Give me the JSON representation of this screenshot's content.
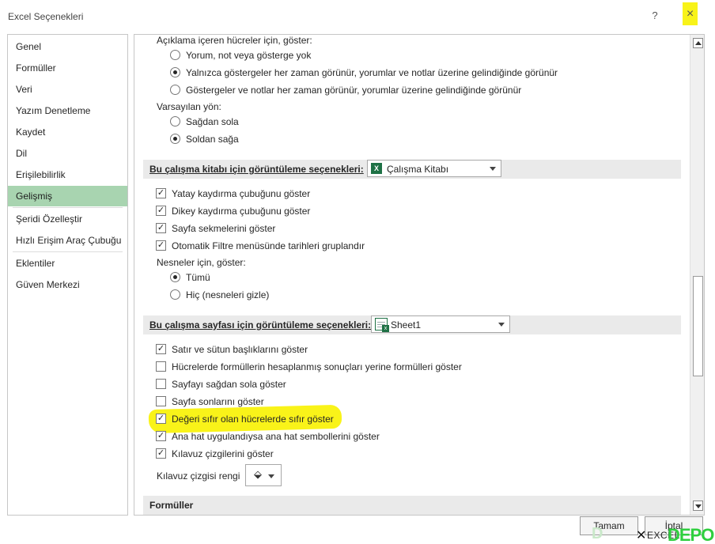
{
  "window": {
    "title": "Excel Seçenekleri",
    "help": "?",
    "close": "×"
  },
  "nav": [
    {
      "label": "Genel",
      "selected": false
    },
    {
      "label": "Formüller",
      "selected": false
    },
    {
      "label": "Veri",
      "selected": false
    },
    {
      "label": "Yazım Denetleme",
      "selected": false
    },
    {
      "label": "Kaydet",
      "selected": false
    },
    {
      "label": "Dil",
      "selected": false
    },
    {
      "label": "Erişilebilirlik",
      "selected": false
    },
    {
      "label": "Gelişmiş",
      "selected": true
    },
    {
      "label": "Şeridi Özelleştir",
      "selected": false
    },
    {
      "label": "Hızlı Erişim Araç Çubuğu",
      "selected": false
    },
    {
      "label": "Eklentiler",
      "selected": false
    },
    {
      "label": "Güven Merkezi",
      "selected": false
    }
  ],
  "comments": {
    "heading": "Açıklama içeren hücreler için, göster:",
    "options": [
      {
        "label": "Yorum, not veya gösterge yok",
        "checked": false
      },
      {
        "label": "Yalnızca göstergeler her zaman görünür, yorumlar ve notlar üzerine gelindiğinde görünür",
        "checked": true
      },
      {
        "label": "Göstergeler ve notlar her zaman görünür, yorumlar üzerine gelindiğinde görünür",
        "checked": false
      }
    ]
  },
  "direction": {
    "heading": "Varsayılan yön:",
    "options": [
      {
        "label": "Sağdan sola",
        "checked": false
      },
      {
        "label": "Soldan sağa",
        "checked": true
      }
    ]
  },
  "workbook_section": {
    "title": "Bu çalışma kitabı için görüntüleme seçenekleri:",
    "dropdown": "Çalışma Kitabı",
    "checks": [
      {
        "label": "Yatay kaydırma çubuğunu göster",
        "checked": true
      },
      {
        "label": "Dikey kaydırma çubuğunu göster",
        "checked": true
      },
      {
        "label": "Sayfa sekmelerini göster",
        "checked": true
      },
      {
        "label": "Otomatik Filtre menüsünde tarihleri gruplandır",
        "checked": true
      }
    ],
    "objects_heading": "Nesneler için, göster:",
    "objects": [
      {
        "label": "Tümü",
        "checked": true
      },
      {
        "label": "Hiç (nesneleri gizle)",
        "checked": false
      }
    ]
  },
  "sheet_section": {
    "title": "Bu çalışma sayfası için görüntüleme seçenekleri:",
    "dropdown": "Sheet1",
    "checks": [
      {
        "label": "Satır ve sütun başlıklarını göster",
        "checked": true
      },
      {
        "label": "Hücrelerde formüllerin hesaplanmış sonuçları yerine formülleri göster",
        "checked": false
      },
      {
        "label": "Sayfayı sağdan sola göster",
        "checked": false
      },
      {
        "label": "Sayfa sonlarını göster",
        "checked": false
      },
      {
        "label": "Değeri sıfır olan hücrelerde sıfır göster",
        "checked": true
      },
      {
        "label": "Ana hat uygulandıysa ana hat sembollerini göster",
        "checked": true
      },
      {
        "label": "Kılavuz çizgilerini göster",
        "checked": true
      }
    ],
    "gridline_color_label": "Kılavuz çizgisi rengi"
  },
  "formulas_section": {
    "title": "Formüller"
  },
  "buttons": {
    "ok": "Tamam",
    "cancel": "İptal"
  },
  "watermark": {
    "text": "EXCEL",
    "logo": "DEPO"
  },
  "colors": {
    "selected_nav": "#a8d4b0",
    "highlight": "#f8f200",
    "excel_green": "#1e7145"
  }
}
